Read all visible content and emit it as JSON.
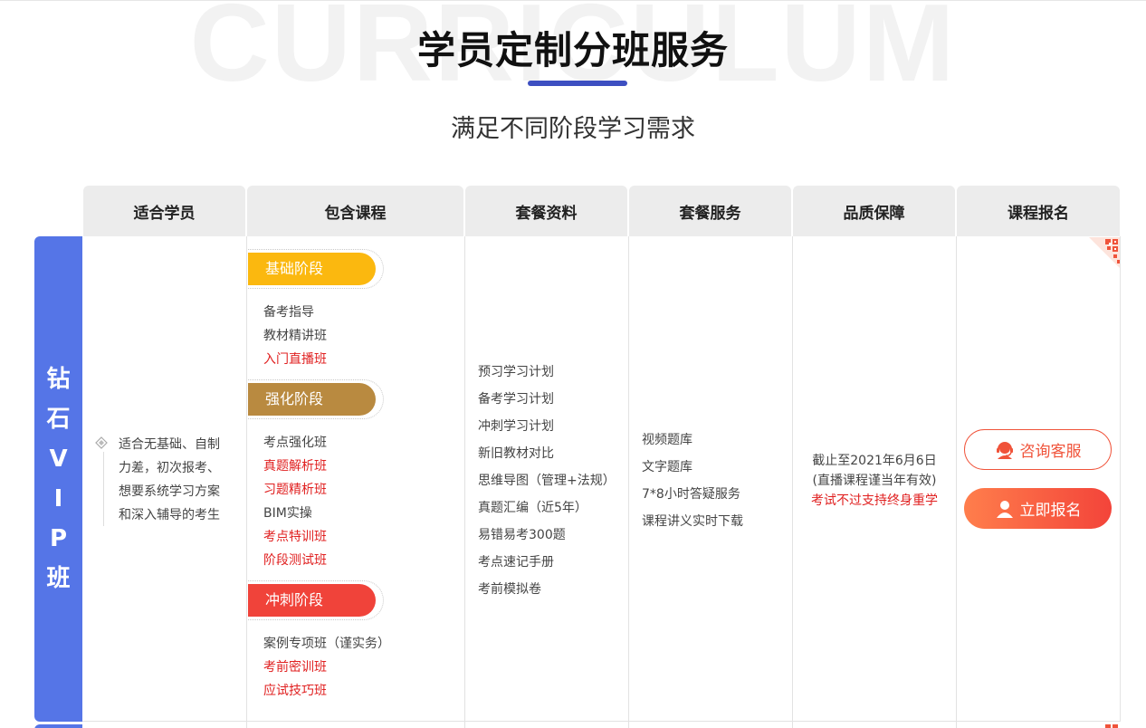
{
  "header": {
    "background_word": "CURRICULUM",
    "title": "学员定制分班服务",
    "subtitle": "满足不同阶段学习需求"
  },
  "columns": [
    "适合学员",
    "包含课程",
    "套餐资料",
    "套餐服务",
    "品质保障",
    "课程报名"
  ],
  "package": {
    "name_chars": [
      "钻",
      "石",
      "V",
      "I",
      "P",
      "班"
    ],
    "suitable_lines": [
      "适合无基础、自制",
      "力差，初次报考、",
      "想要系统学习方案",
      "和深入辅导的考生"
    ],
    "stages": [
      {
        "label": "基础阶段",
        "color": "#fbb80f",
        "courses": [
          {
            "name": "备考指导",
            "highlight": false
          },
          {
            "name": "教材精讲班",
            "highlight": false
          },
          {
            "name": "入门直播班",
            "highlight": true
          }
        ]
      },
      {
        "label": "强化阶段",
        "color": "#b98a40",
        "courses": [
          {
            "name": "考点强化班",
            "highlight": false
          },
          {
            "name": "真题解析班",
            "highlight": true
          },
          {
            "name": "习题精析班",
            "highlight": true
          },
          {
            "name": "BIM实操",
            "highlight": false
          },
          {
            "name": "考点特训班",
            "highlight": true
          },
          {
            "name": "阶段测试班",
            "highlight": true
          }
        ]
      },
      {
        "label": "冲刺阶段",
        "color": "#f0433a",
        "courses": [
          {
            "name": "案例专项班（谨实务）",
            "highlight": false
          },
          {
            "name": "考前密训班",
            "highlight": true
          },
          {
            "name": "应试技巧班",
            "highlight": true
          }
        ]
      }
    ],
    "materials": [
      "预习学习计划",
      "备考学习计划",
      "冲刺学习计划",
      "新旧教材对比",
      "思维导图（管理+法规）",
      "真题汇编（近5年）",
      "易错易考300题",
      "考点速记手册",
      "考前模拟卷"
    ],
    "services": [
      "视频题库",
      "文字题库",
      "7*8小时答疑服务",
      "课程讲义实时下载"
    ],
    "quality": [
      "截止至2021年6月6日",
      "(直播课程谨当年有效)",
      "考试不过支持终身重学"
    ],
    "buttons": {
      "consult": "咨询客服",
      "enroll": "立即报名"
    },
    "accent_color": "#5575e7",
    "highlight_color": "#e02020"
  }
}
